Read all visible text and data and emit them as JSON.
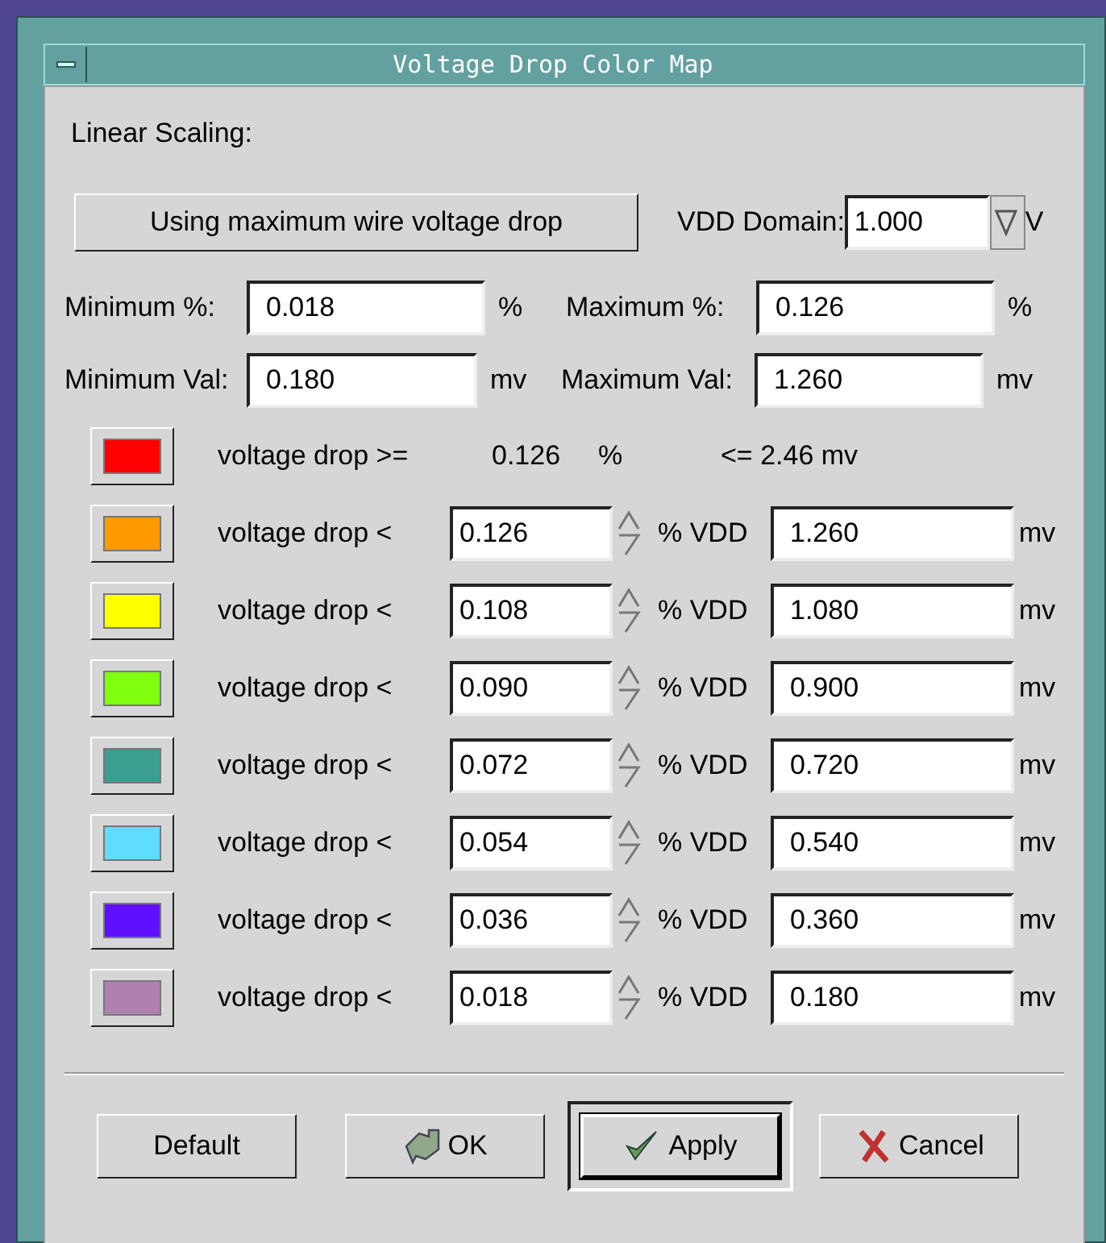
{
  "window": {
    "title": "Voltage Drop Color Map"
  },
  "section_label": "Linear Scaling:",
  "mode_button": "Using maximum wire voltage drop",
  "vdd_domain": {
    "label": "VDD Domain:",
    "value": "1.000",
    "unit": "V"
  },
  "limits": [
    {
      "label": "Minimum %:",
      "value": "0.018",
      "unit": "%"
    },
    {
      "label": "Maximum %:",
      "value": "0.126",
      "unit": "%"
    },
    {
      "label": "Minimum Val:",
      "value": "0.180",
      "unit": "mv"
    },
    {
      "label": "Maximum Val:",
      "value": "1.260",
      "unit": "mv"
    }
  ],
  "top_band": {
    "color": "#ff0000",
    "label": "voltage drop >=",
    "percent": "0.126",
    "percent_unit": "%",
    "limit": "<= 2.46 mv"
  },
  "bands": [
    {
      "color": "#ff9a00",
      "label": "voltage drop <",
      "percent": "0.126",
      "percent_unit": "% VDD",
      "value": "1.260",
      "unit": "mv"
    },
    {
      "color": "#ffff00",
      "label": "voltage drop <",
      "percent": "0.108",
      "percent_unit": "% VDD",
      "value": "1.080",
      "unit": "mv"
    },
    {
      "color": "#80ff10",
      "label": "voltage drop <",
      "percent": "0.090",
      "percent_unit": "% VDD",
      "value": "0.900",
      "unit": "mv"
    },
    {
      "color": "#3a9e90",
      "label": "voltage drop <",
      "percent": "0.072",
      "percent_unit": "% VDD",
      "value": "0.720",
      "unit": "mv"
    },
    {
      "color": "#60dcff",
      "label": "voltage drop <",
      "percent": "0.054",
      "percent_unit": "% VDD",
      "value": "0.540",
      "unit": "mv"
    },
    {
      "color": "#6010ff",
      "label": "voltage drop <",
      "percent": "0.036",
      "percent_unit": "% VDD",
      "value": "0.360",
      "unit": "mv"
    },
    {
      "color": "#b080b0",
      "label": "voltage drop <",
      "percent": "0.018",
      "percent_unit": "% VDD",
      "value": "0.180",
      "unit": "mv"
    }
  ],
  "buttons": [
    {
      "label": "Default",
      "kind": "plain",
      "default": false
    },
    {
      "label": "OK",
      "kind": "hand",
      "default": false
    },
    {
      "label": "Apply",
      "kind": "check",
      "default": true
    },
    {
      "label": "Cancel",
      "kind": "cross",
      "default": false
    }
  ]
}
